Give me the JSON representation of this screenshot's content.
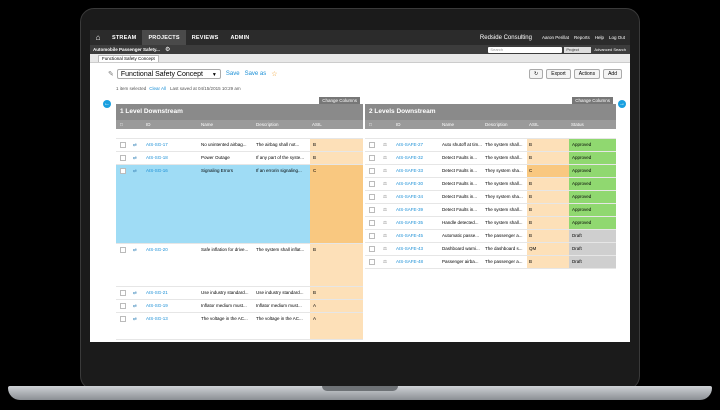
{
  "nav": {
    "tabs": [
      {
        "label": "STREAM"
      },
      {
        "label": "PROJECTS"
      },
      {
        "label": "REVIEWS"
      },
      {
        "label": "ADMIN"
      }
    ],
    "company": "Redside Consulting",
    "user": "Aaron Perillat",
    "links": [
      "Reports",
      "Help",
      "Log Out"
    ]
  },
  "subbar": {
    "project": "Automobile Passenger Safety...",
    "search_placeholder": "Search",
    "scope": "Project",
    "advanced": "Advanced Search"
  },
  "doc_tab": "Functional Safety Concept",
  "toolbar": {
    "doc_select": "Functional Safety Concept",
    "save": "Save",
    "save_as": "Save as",
    "export": "Export",
    "actions": "Actions",
    "add": "Add"
  },
  "info": {
    "selected": "1 item selected",
    "clear_all": "Clear All",
    "last_saved": "Last saved at 04/15/2015 10:29 am"
  },
  "left": {
    "change_columns": "Change Columns",
    "title": "1 Level Downstream",
    "headers": {
      "id": "ID",
      "name": "Name",
      "desc": "Description",
      "asil": "ASIL"
    },
    "rows": [
      {
        "id": "",
        "name": "",
        "desc": "",
        "asil": ""
      },
      {
        "id": "AIS-SG-17",
        "name": "No unintented airbag...",
        "desc": "The airbag shall not...",
        "asil": "B"
      },
      {
        "id": "AIS-SG-18",
        "name": "Power Outage",
        "desc": "If any part of the syste...",
        "asil": "B"
      },
      {
        "id": "AIS-SG-16",
        "name": "Signaling Errors",
        "desc": "If an errorin signaling...",
        "asil": "C"
      },
      {
        "id": "AIS-SG-20",
        "name": "Safe inflation for drive...",
        "desc": "The system shall inflat...",
        "asil": "B"
      },
      {
        "id": "AIS-SG-21",
        "name": "Use industry standard...",
        "desc": "Use industry standard...",
        "asil": "B"
      },
      {
        "id": "AIS-SG-19",
        "name": "Inflator medium must...",
        "desc": "Inflator medium must...",
        "asil": "A"
      },
      {
        "id": "AIS-SG-13",
        "name": "The voltage in the AC...",
        "desc": "The voltage in the AC...",
        "asil": "A"
      }
    ]
  },
  "right": {
    "change_columns": "Change Columns",
    "title": "2 Levels Downstream",
    "headers": {
      "id": "ID",
      "name": "Name",
      "desc": "Description",
      "asil": "ASIL",
      "status": "Status"
    },
    "rows": [
      {
        "id": "",
        "name": "",
        "desc": "",
        "asil": "",
        "status": ""
      },
      {
        "id": "AIS-SAFE-27",
        "name": "Auto shutoff at tim...",
        "desc": "The system shall...",
        "asil": "B",
        "status": "Approved"
      },
      {
        "id": "AIS-SAFE-32",
        "name": "Detect Faults in...",
        "desc": "The system shall...",
        "asil": "B",
        "status": "Approved"
      },
      {
        "id": "AIS-SAFE-33",
        "name": "Detect Faults in...",
        "desc": "They system sha...",
        "asil": "C",
        "status": "Approved"
      },
      {
        "id": "AIS-SAFE-30",
        "name": "Detect Faults in...",
        "desc": "The system shall...",
        "asil": "B",
        "status": "Approved"
      },
      {
        "id": "AIS-SAFE-34",
        "name": "Detect Faults in...",
        "desc": "They system sha...",
        "asil": "B",
        "status": "Approved"
      },
      {
        "id": "AIS-SAFE-39",
        "name": "Detect Faults in...",
        "desc": "The system shall...",
        "asil": "B",
        "status": "Approved"
      },
      {
        "id": "AIS-SAFE-35",
        "name": "Handle detected...",
        "desc": "The system shall...",
        "asil": "B",
        "status": "Approved"
      },
      {
        "id": "AIS-SAFE-45",
        "name": "Automatic passe...",
        "desc": "The passenger a...",
        "asil": "B",
        "status": "Draft"
      },
      {
        "id": "AIS-SAFE-43",
        "name": "Dashboard warni...",
        "desc": "The dashboard s...",
        "asil": "QM",
        "status": "Draft"
      },
      {
        "id": "AIS-SAFE-48",
        "name": "Passenger airba...",
        "desc": "The passenger a...",
        "asil": "B",
        "status": "Draft"
      }
    ]
  },
  "colors": {
    "accent": "#1a8fd6",
    "approved": "#90d870",
    "draft": "#cfcfcf",
    "asil_c": "#f9c880",
    "asil_b": "#fde0b8",
    "selected": "#9fdcf5"
  }
}
